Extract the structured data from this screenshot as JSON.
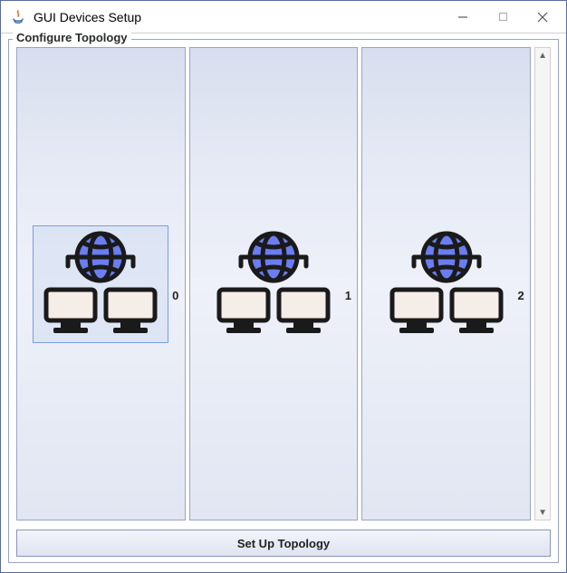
{
  "window": {
    "title": "GUI Devices Setup",
    "icon": "java-icon"
  },
  "group": {
    "legend": "Configure Topology"
  },
  "nodes": [
    {
      "label": "0",
      "selected": true
    },
    {
      "label": "1",
      "selected": false
    },
    {
      "label": "2",
      "selected": false
    }
  ],
  "buttons": {
    "set_up": "Set Up Topology"
  }
}
